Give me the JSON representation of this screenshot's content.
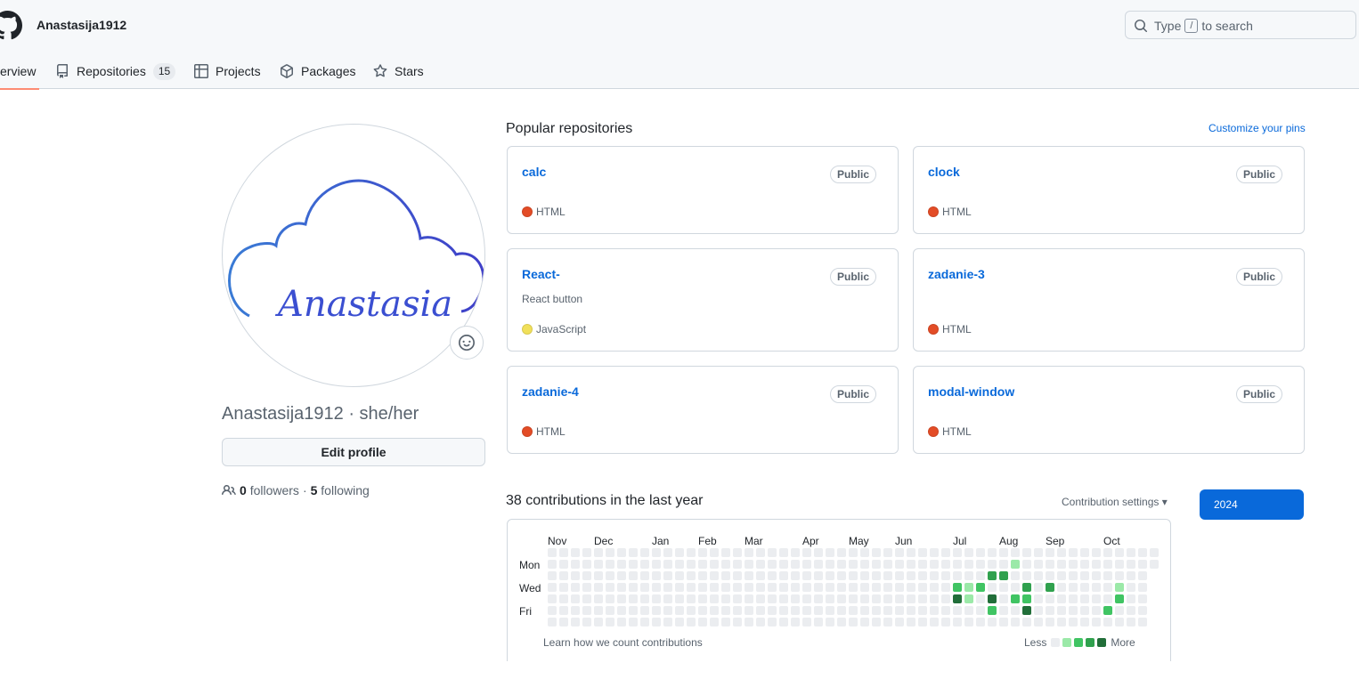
{
  "header": {
    "username": "Anastasija1912",
    "search": {
      "prefix": "Type",
      "key": "/",
      "suffix": "to search"
    },
    "tabs": [
      {
        "label": "Overview",
        "visible_label": "erview",
        "icon": "book-open-icon",
        "active": true
      },
      {
        "label": "Repositories",
        "icon": "repo-icon",
        "count": "15"
      },
      {
        "label": "Projects",
        "icon": "table-icon"
      },
      {
        "label": "Packages",
        "icon": "package-icon"
      },
      {
        "label": "Stars",
        "icon": "star-icon"
      }
    ]
  },
  "profile": {
    "avatar_text": "Anastasia",
    "login": "Anastasija1912",
    "pronouns_line": "Anastasija1912 · she/her",
    "edit_label": "Edit profile",
    "followers_count": "0",
    "followers_label": "followers",
    "sep": "·",
    "following_count": "5",
    "following_label": "following"
  },
  "pinned": {
    "title": "Popular repositories",
    "customize_label": "Customize your pins",
    "repos": [
      {
        "name": "calc",
        "visibility": "Public",
        "description": "",
        "language": "HTML",
        "color": "#e34c26"
      },
      {
        "name": "clock",
        "visibility": "Public",
        "description": "",
        "language": "HTML",
        "color": "#e34c26"
      },
      {
        "name": "React-",
        "visibility": "Public",
        "description": "React button",
        "language": "JavaScript",
        "color": "#f1e05a"
      },
      {
        "name": "zadanie-3",
        "visibility": "Public",
        "description": "",
        "language": "HTML",
        "color": "#e34c26"
      },
      {
        "name": "zadanie-4",
        "visibility": "Public",
        "description": "",
        "language": "HTML",
        "color": "#e34c26"
      },
      {
        "name": "modal-window",
        "visibility": "Public",
        "description": "",
        "language": "HTML",
        "color": "#e34c26"
      }
    ]
  },
  "contributions": {
    "title": "38 contributions in the last year",
    "settings_label": "Contribution settings",
    "year": "2024",
    "months": [
      "Nov",
      "Dec",
      "Jan",
      "Feb",
      "Mar",
      "Apr",
      "May",
      "Jun",
      "Jul",
      "Aug",
      "Sep",
      "Oct"
    ],
    "days": [
      "Mon",
      "Wed",
      "Fri"
    ],
    "learn_label": "Learn how we count contributions",
    "less_label": "Less",
    "more_label": "More",
    "levels_colors": [
      "#ebedf0",
      "#9be9a8",
      "#40c463",
      "#30a14e",
      "#216e39"
    ],
    "active_cells": [
      {
        "week": 40,
        "day": 1,
        "level": 1
      },
      {
        "week": 38,
        "day": 2,
        "level": 3
      },
      {
        "week": 39,
        "day": 2,
        "level": 3
      },
      {
        "week": 35,
        "day": 3,
        "level": 2
      },
      {
        "week": 36,
        "day": 3,
        "level": 1
      },
      {
        "week": 37,
        "day": 3,
        "level": 2
      },
      {
        "week": 41,
        "day": 3,
        "level": 3
      },
      {
        "week": 43,
        "day": 3,
        "level": 3
      },
      {
        "week": 49,
        "day": 3,
        "level": 1
      },
      {
        "week": 35,
        "day": 4,
        "level": 4
      },
      {
        "week": 36,
        "day": 4,
        "level": 1
      },
      {
        "week": 38,
        "day": 4,
        "level": 4
      },
      {
        "week": 40,
        "day": 4,
        "level": 2
      },
      {
        "week": 41,
        "day": 4,
        "level": 2
      },
      {
        "week": 49,
        "day": 4,
        "level": 2
      },
      {
        "week": 38,
        "day": 5,
        "level": 2
      },
      {
        "week": 41,
        "day": 5,
        "level": 4
      },
      {
        "week": 48,
        "day": 5,
        "level": 2
      }
    ]
  }
}
